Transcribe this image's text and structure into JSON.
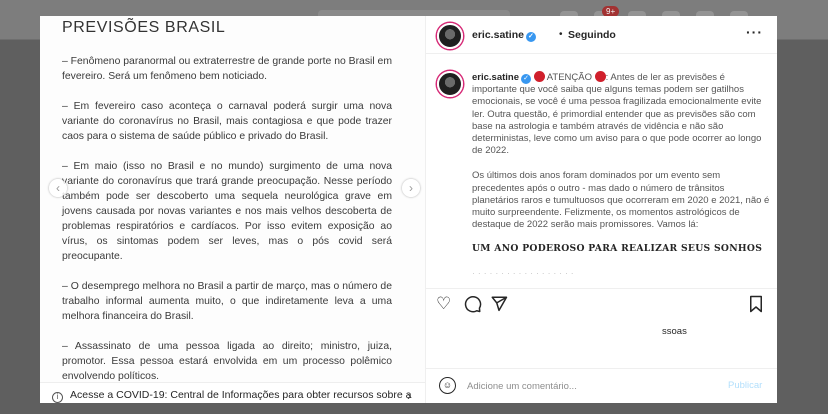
{
  "background": {
    "notification_count": "9+"
  },
  "image": {
    "title": "PREVISÕES BRASIL",
    "paragraphs": [
      "– Fenômeno paranormal ou extraterrestre de grande porte no Brasil em fevereiro. Será um fenômeno bem noticiado.",
      "– Em fevereiro caso aconteça o carnaval poderá surgir uma nova variante do coronavírus no Brasil, mais contagiosa e que pode trazer caos para o sistema de saúde público e privado do Brasil.",
      "– Em maio (isso no Brasil e no mundo) surgimento de uma nova variante do coronavírus que trará grande preocupação. Nesse período também pode ser descoberto uma sequela neurológica grave em jovens causada por novas variantes e nos mais velhos descoberta de problemas respiratórios e cardíacos. Por isso evitem exposição ao vírus, os sintomas podem ser leves, mas o pós covid será preocupante.",
      "– O desemprego melhora no Brasil a partir de março, mas o número de trabalho informal aumenta muito, o que indiretamente leva a uma melhora financeira do Brasil.",
      "– Assassinato de uma pessoa ligada ao direito; ministro, juiza, promotor. Essa pessoa estará envolvida em um processo polêmico envolvendo políticos."
    ],
    "covid_notice": "Acesse a COVID-19: Central de Informações para obter recursos sobre a"
  },
  "header": {
    "username": "eric.satine",
    "dot": "•",
    "follow_status": "Seguindo",
    "more": "···"
  },
  "caption": {
    "username": "eric.satine",
    "attention": "ATENÇÃO",
    "p1_rest": ": Antes de ler as previsões é importante que você saiba que alguns temas podem ser gatilhos emocionais, se você é uma pessoa fragilizada emocionalmente evite ler. Outra questão, é primordial entender que as previsões são com base na astrologia e também através de vidência e não são deterministas, leve como um aviso para o que pode ocorrer ao longo de 2022.",
    "p2": "Os últimos dois anos foram dominados por um evento sem precedentes após o outro - mas dado o número de trânsitos planetários raros e tumultuosos que ocorreram em 2020 e 2021, não é muito surpreendente. Felizmente, os momentos astrológicos de destaque de 2022 serão mais promissores. Vamos lá:",
    "heading": "UM ANO PODEROSO PARA REALIZAR SEUS SONHOS"
  },
  "actions": {
    "likes_text": "ssoas"
  },
  "comment_box": {
    "placeholder": "Adicione um comentário...",
    "publish_label": "Publicar"
  },
  "colors": {
    "accent_blue": "#3897f0",
    "attention_red": "#d0202c",
    "publish_disabled": "#b2dffc"
  }
}
